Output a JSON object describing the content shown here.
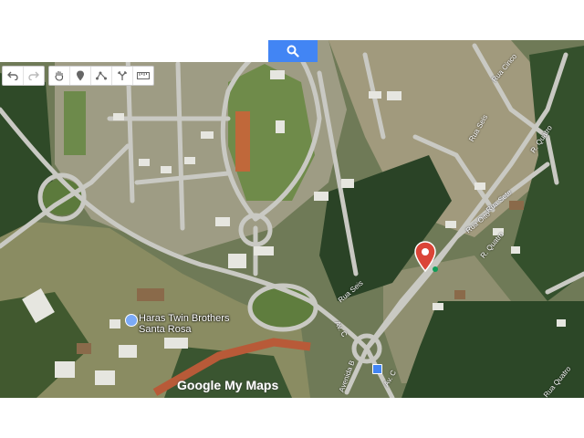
{
  "search": {
    "placeholder": "",
    "value": "",
    "button_icon": "search-icon"
  },
  "toolbar": {
    "groups": [
      [
        "undo-icon",
        "redo-icon"
      ],
      [
        "hand-icon",
        "add-marker-icon",
        "draw-line-icon",
        "directions-icon",
        "ruler-icon"
      ]
    ]
  },
  "map": {
    "place_label": "Haras Twin Brothers\nSanta Rosa",
    "street_labels": {
      "rua_seis_north": "Rua Seis",
      "rua_cinco": "Rua Cinco",
      "rua_sete": "Rua Sete",
      "r_quatro_top": "R. Quatro",
      "rua_oito": "Rua Oito",
      "rua_seis_south": "Rua Seis",
      "r_quatro_mid": "R. Quatro",
      "av_c_left": "Av. C",
      "av_c_right": "Av. C",
      "avenida_b": "Avenida B",
      "r_quatro_bottom": "Rua Quatro"
    },
    "logo": "Google My Maps",
    "colors": {
      "search_button": "#4285f4",
      "marker": "#db4437",
      "pin_accent": "#0f9d58"
    }
  }
}
